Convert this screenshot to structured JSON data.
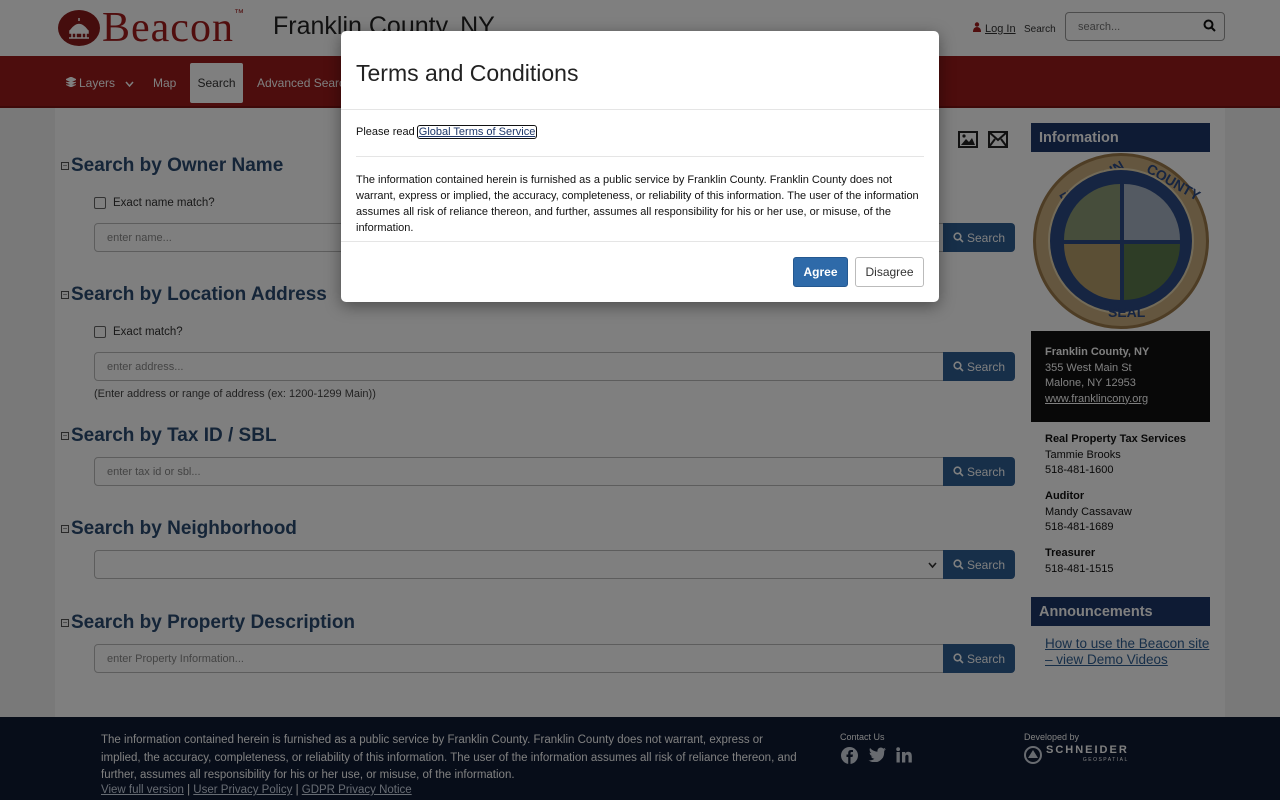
{
  "header": {
    "brand": "Beacon",
    "brand_tm": "™",
    "county_title": "Franklin County, NY",
    "login_label": "Log In",
    "search_label": "Search",
    "search_placeholder": "search..."
  },
  "nav": {
    "layers": "Layers",
    "map": "Map",
    "search": "Search",
    "advanced_search": "Advanced Search"
  },
  "sections": {
    "owner": {
      "title": "Search by Owner Name",
      "check_label": "Exact name match?",
      "placeholder": "enter name...",
      "button": "Search"
    },
    "location": {
      "title": "Search by Location Address",
      "check_label": "Exact match?",
      "placeholder": "enter address...",
      "button": "Search",
      "hint": "(Enter address or range of address (ex: 1200-1299 Main))"
    },
    "taxid": {
      "title": "Search by Tax ID / SBL",
      "placeholder": "enter tax id or sbl...",
      "button": "Search"
    },
    "neighborhood": {
      "title": "Search by Neighborhood",
      "selected": "",
      "button": "Search"
    },
    "description": {
      "title": "Search by Property Description",
      "placeholder": "enter Property Information...",
      "button": "Search"
    }
  },
  "sidebar": {
    "info_title": "Information",
    "seal_top": "FRANKLIN",
    "seal_right": "COUNTY",
    "seal_bottom": "SEAL",
    "contact": {
      "name": "Franklin County, NY",
      "street": "355 West Main St",
      "city": "Malone, NY 12953",
      "website": "www.franklincony.org"
    },
    "staff": [
      {
        "role": "Real Property Tax Services",
        "name": "Tammie Brooks",
        "phone": "518-481-1600"
      },
      {
        "role": "Auditor",
        "name": "Mandy Cassavaw",
        "phone": "518-481-1689"
      },
      {
        "role": "Treasurer",
        "name": "",
        "phone": "518-481-1515"
      }
    ],
    "announcements_title": "Announcements",
    "announcement_link": "How to use the Beacon site – view Demo Videos"
  },
  "footer": {
    "disclaimer": "The information contained herein is furnished as a public service by Franklin County. Franklin County does not warrant, express or implied, the accuracy, completeness, or reliability of this information. The user of the information assumes all risk of reliance thereon, and further, assumes all responsibility for his or her use, or misuse, of the information.",
    "link_full": "View full version",
    "link_privacy": "User Privacy Policy",
    "link_gdpr": "GDPR Privacy Notice",
    "sep": "|",
    "contact_us": "Contact Us",
    "developed_by": "Developed by",
    "developer": "SCHNEIDER",
    "developer_sub": "GEOSPATIAL"
  },
  "modal": {
    "title": "Terms and Conditions",
    "read_prefix": "Please read",
    "read_link": "Global Terms of Service",
    "body": "The information contained herein is furnished as a public service by Franklin County. Franklin County does not warrant, express or implied, the accuracy, completeness, or reliability of this information. The user of the information assumes all risk of reliance thereon, and further, assumes all responsibility for his or her use, or misuse, of the information.",
    "agree": "Agree",
    "disagree": "Disagree"
  },
  "colors": {
    "brand_red": "#9a1b1b",
    "navy": "#1d3668",
    "button_blue": "#2e5f93"
  }
}
